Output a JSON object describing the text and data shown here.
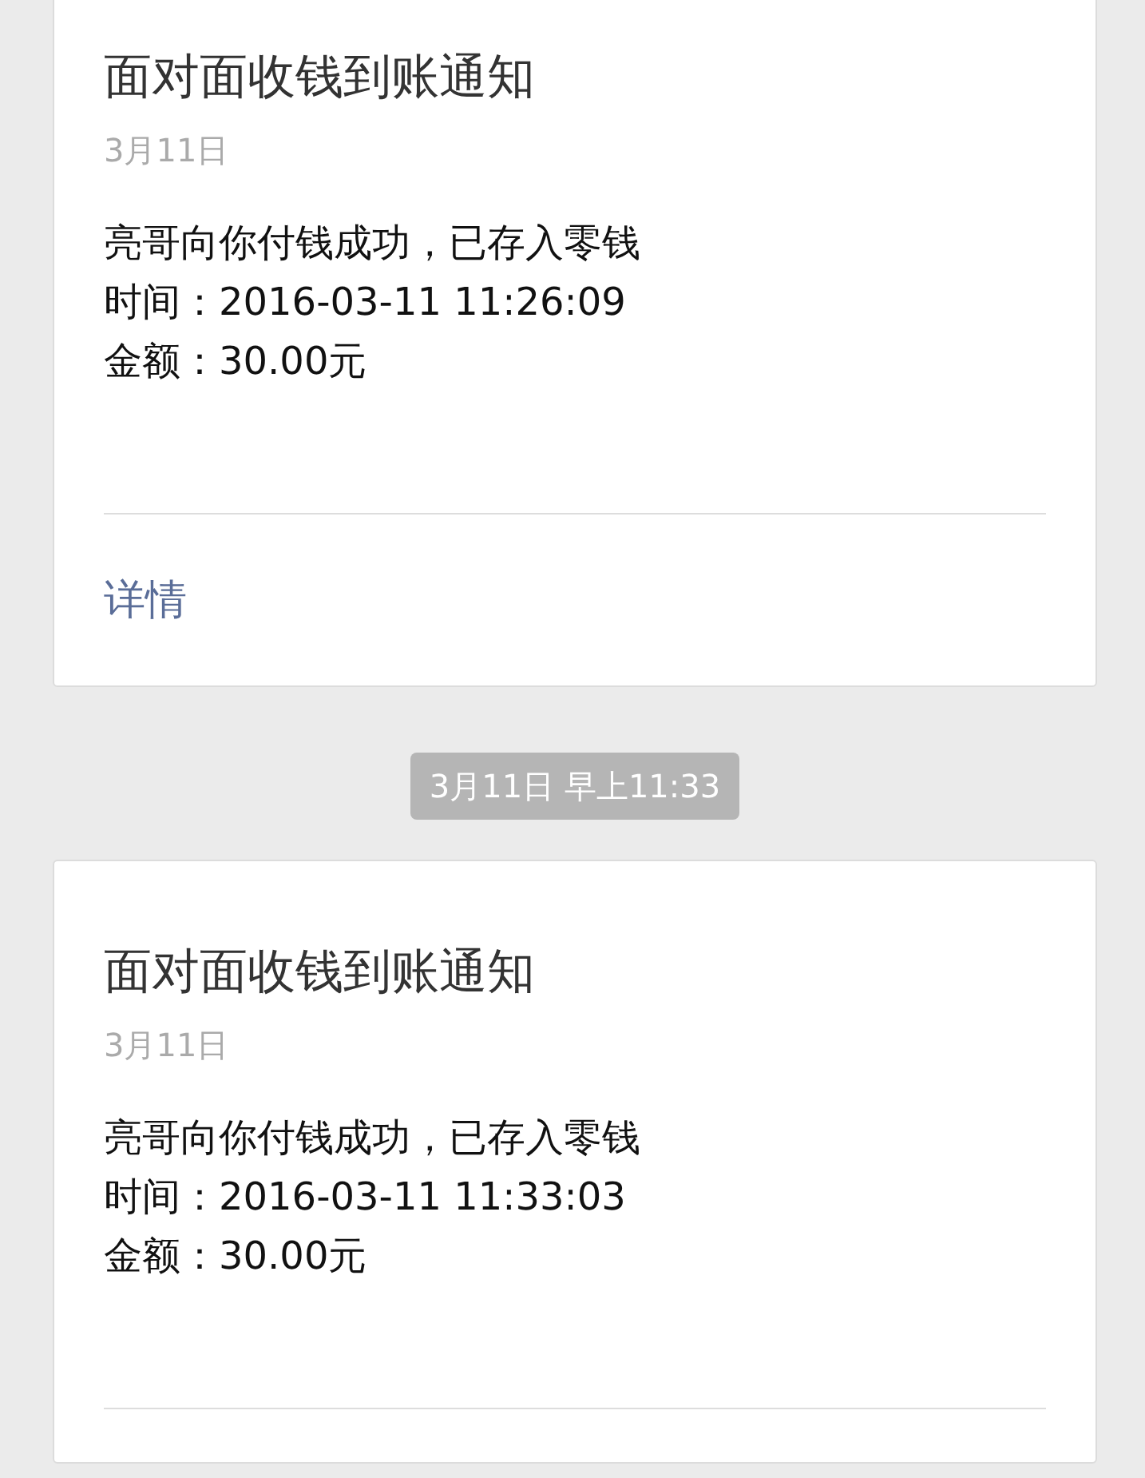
{
  "messages": [
    {
      "kind": "card",
      "title": "面对面收钱到账通知",
      "date": "3月11日",
      "lines": [
        "亮哥向你付钱成功，已存入零钱",
        "时间：2016-03-11 11:26:09",
        "金额：30.00元"
      ],
      "link": "详情"
    },
    {
      "kind": "timestamp",
      "text": "3月11日 早上11:33"
    },
    {
      "kind": "card",
      "title": "面对面收钱到账通知",
      "date": "3月11日",
      "lines": [
        "亮哥向你付钱成功，已存入零钱",
        "时间：2016-03-11 11:33:03",
        "金额：30.00元"
      ]
    }
  ]
}
